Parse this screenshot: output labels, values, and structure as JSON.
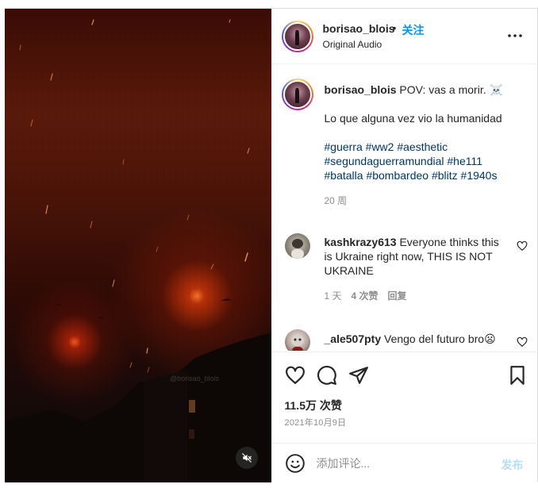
{
  "post": {
    "author": "borisao_blois",
    "separator": "•",
    "follow_label": "关注",
    "audio_label": "Original Audio",
    "watermark": "@borisao_blois",
    "caption": {
      "username": "borisao_blois",
      "text": "POV: vas a morir. ☠️",
      "line2": "Lo que alguna vez vio la humanidad",
      "hashtags": [
        "#guerra",
        "#ww2",
        "#aesthetic",
        "#segundaguerramundial",
        "#he111",
        "#batalla",
        "#bombardeo",
        "#blitz",
        "#1940s"
      ],
      "time": "20 周"
    },
    "comments": [
      {
        "username": "kashkrazy613",
        "text": "Everyone thinks this is Ukraine right now, THIS IS NOT UKRAINE",
        "time": "1 天",
        "likes": "4 次赞",
        "reply": "回复"
      },
      {
        "username": "_ale507pty",
        "text": "Vengo del futuro bro😦"
      }
    ],
    "likes": "11.5万 次赞",
    "date": "2021年10月9日",
    "add_comment": {
      "placeholder": "添加评论...",
      "post_label": "发布"
    },
    "colors": {
      "accent": "#0095f6",
      "hashtag": "#00376b",
      "post_disabled": "#b2dffc"
    },
    "icons": [
      "more-icon",
      "heart-icon",
      "comment-icon",
      "share-icon",
      "save-icon",
      "emoji-icon",
      "muted-icon"
    ]
  }
}
